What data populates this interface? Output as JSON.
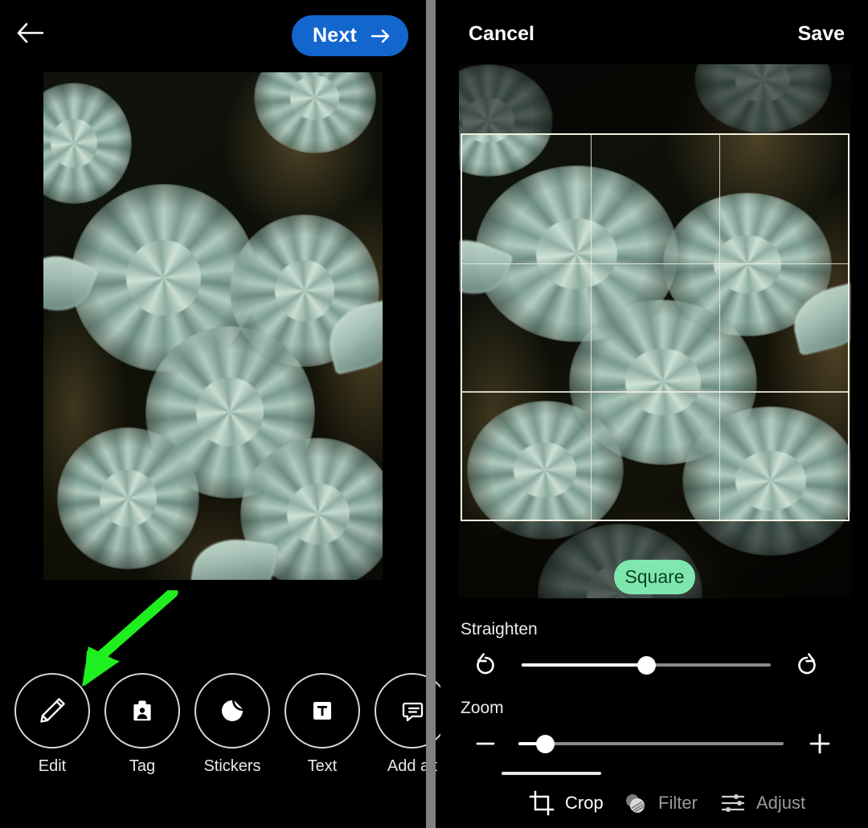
{
  "left_panel": {
    "header": {
      "back_icon": "arrow-left-icon",
      "next_label": "Next",
      "next_icon": "arrow-right-icon",
      "next_color": "#1366CE"
    },
    "photo": {
      "alt": "Close-up photograph of pale blue-green succulent rosettes (echeveria) on a dark brown background"
    },
    "annotation": {
      "type": "arrow",
      "color": "#1FEE1F",
      "points_to": "Edit"
    },
    "tools": [
      {
        "label": "Edit",
        "icon": "pencil-icon"
      },
      {
        "label": "Tag",
        "icon": "tag-person-icon"
      },
      {
        "label": "Stickers",
        "icon": "sticker-icon"
      },
      {
        "label": "Text",
        "icon": "text-box-icon"
      },
      {
        "label": "Add alt",
        "icon": "alt-text-bubble-icon"
      }
    ]
  },
  "right_panel": {
    "header": {
      "cancel_label": "Cancel",
      "save_label": "Save"
    },
    "photo": {
      "alt": "Close-up photograph of pale blue-green succulent rosettes (echeveria) on a dark brown background"
    },
    "crop": {
      "grid": "rule-of-thirds",
      "grid_color": "#F2EFE0",
      "aspect_label": "Square",
      "aspect_bg": "#7FE7AD",
      "aspect_text_color": "#0A4226"
    },
    "straighten": {
      "label": "Straighten",
      "rotate_left_icon": "rotate-counterclockwise-icon",
      "rotate_right_icon": "rotate-clockwise-icon",
      "value_percent": 50
    },
    "zoom": {
      "label": "Zoom",
      "minus_icon": "minus-icon",
      "plus_icon": "plus-icon",
      "value_percent": 10
    },
    "tabs": [
      {
        "label": "Crop",
        "icon": "crop-icon",
        "active": true
      },
      {
        "label": "Filter",
        "icon": "filter-icon",
        "active": false
      },
      {
        "label": "Adjust",
        "icon": "adjust-sliders-icon",
        "active": false
      }
    ]
  }
}
